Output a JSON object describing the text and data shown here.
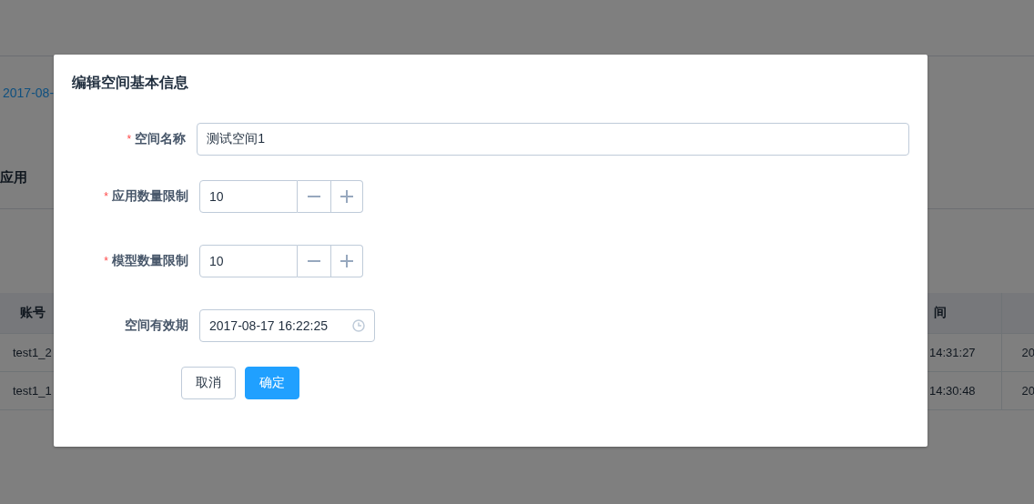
{
  "background": {
    "date_link": "2017-08-",
    "section_title": "应用",
    "table": {
      "header": [
        "账号",
        "间"
      ],
      "rows": [
        [
          "test1_2",
          "14:31:27",
          "20"
        ],
        [
          "test1_1",
          "14:30:48",
          "20"
        ]
      ]
    }
  },
  "dialog": {
    "title": "编辑空间基本信息",
    "fields": [
      {
        "kind": "text",
        "label": "空间名称",
        "required_mark": "*",
        "value": "测试空间1"
      },
      {
        "kind": "number",
        "label": "应用数量限制",
        "required_mark": "*",
        "value": "10"
      },
      {
        "kind": "number",
        "label": "模型数量限制",
        "required_mark": "*",
        "value": "10"
      },
      {
        "kind": "datetime",
        "label": "空间有效期",
        "value": "2017-08-17 16:22:25"
      }
    ],
    "buttons": [
      {
        "kind": "default",
        "label": "取消"
      },
      {
        "kind": "primary",
        "label": "确定"
      }
    ]
  }
}
